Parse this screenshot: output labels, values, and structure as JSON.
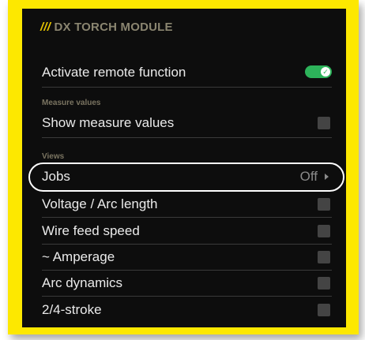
{
  "header": {
    "slashes": "///",
    "title": "DX TORCH MODULE"
  },
  "remote": {
    "label": "Activate remote function",
    "enabled": true
  },
  "sections": {
    "measure_values": "Measure values",
    "views": "Views"
  },
  "measure": {
    "show_label": "Show measure values",
    "checked": false
  },
  "jobs": {
    "label": "Jobs",
    "value": "Off"
  },
  "views": {
    "items": [
      {
        "label": "Voltage / Arc length",
        "checked": false
      },
      {
        "label": "Wire feed speed",
        "checked": false
      },
      {
        "label": "~ Amperage",
        "checked": false
      },
      {
        "label": "Arc dynamics",
        "checked": false
      },
      {
        "label": "2/4-stroke",
        "checked": false
      }
    ]
  },
  "colors": {
    "highlight_frame": "#fde800",
    "accent_title": "#e6c400",
    "toggle_on": "#2db35a",
    "panel_bg": "#0d0d0d"
  },
  "icons": {
    "toggle_knob": "checkmark-icon",
    "jobs_arrow": "chevron-right-icon"
  }
}
